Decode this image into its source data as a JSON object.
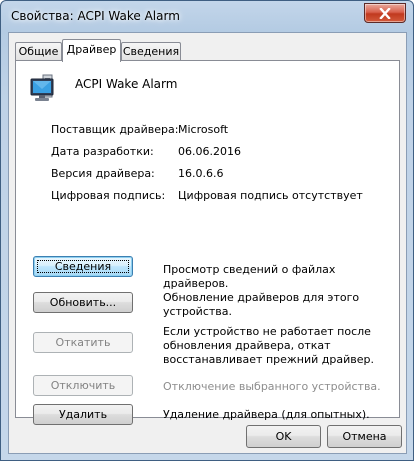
{
  "window": {
    "title": "Свойства: ACPI Wake Alarm"
  },
  "tabs": [
    {
      "label": "Общие"
    },
    {
      "label": "Драйвер"
    },
    {
      "label": "Сведения"
    }
  ],
  "device": {
    "name": "ACPI Wake Alarm",
    "icon": "monitor-computer-icon"
  },
  "properties": [
    {
      "label": "Поставщик драйвера:",
      "value": "Microsoft"
    },
    {
      "label": "Дата разработки:",
      "value": "06.06.2016"
    },
    {
      "label": "Версия драйвера:",
      "value": "16.0.6.6"
    },
    {
      "label": "Цифровая подпись:",
      "value": "Цифровая подпись отсутствует"
    }
  ],
  "actions": [
    {
      "button": "Сведения",
      "description": "Просмотр сведений о файлах драйверов.",
      "enabled": true
    },
    {
      "button": "Обновить...",
      "description": "Обновление драйверов для этого устройства.",
      "enabled": true
    },
    {
      "button": "Откатить",
      "description": "Если устройство не работает после обновления драйвера, откат восстанавливает прежний драйвер.",
      "enabled": false
    },
    {
      "button": "Отключить",
      "description": "Отключение выбранного устройства.",
      "enabled": false
    },
    {
      "button": "Удалить",
      "description": "Удаление драйвера (для опытных).",
      "enabled": true
    }
  ],
  "footer": {
    "ok": "OK",
    "cancel": "Отмена"
  },
  "colors": {
    "title_bar": "#b9cfe6",
    "close_button": "#c1391f",
    "focused_button": "#bee6fd",
    "disabled_text": "#838383"
  }
}
